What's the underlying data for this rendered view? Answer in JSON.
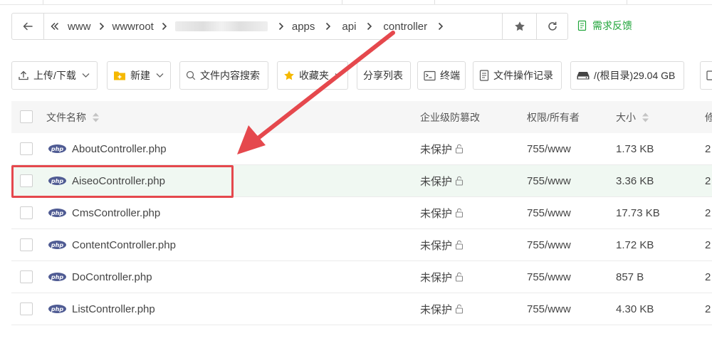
{
  "address_bar": {
    "crumbs": [
      "www",
      "wwwroot",
      "",
      "apps",
      "api",
      "controller"
    ]
  },
  "feedback": {
    "label": "需求反馈"
  },
  "toolbar": {
    "upload": "上传/下载",
    "new": "新建",
    "search_content": "文件内容搜索",
    "favorites": "收藏夹",
    "share_list": "分享列表",
    "terminal": "终端",
    "file_log": "文件操作记录",
    "disk": "/(根目录)29.04 GB"
  },
  "table": {
    "headers": {
      "name": "文件名称",
      "protect": "企业级防篡改",
      "perm": "权限/所有者",
      "size": "大小",
      "modified": "修"
    },
    "rows": [
      {
        "name": "AboutController.php",
        "protect": "未保护",
        "perm": "755/www",
        "size": "1.73 KB",
        "mod": "2"
      },
      {
        "name": "AiseoController.php",
        "protect": "未保护",
        "perm": "755/www",
        "size": "3.36 KB",
        "mod": "2"
      },
      {
        "name": "CmsController.php",
        "protect": "未保护",
        "perm": "755/www",
        "size": "17.73 KB",
        "mod": "2"
      },
      {
        "name": "ContentController.php",
        "protect": "未保护",
        "perm": "755/www",
        "size": "1.72 KB",
        "mod": "2"
      },
      {
        "name": "DoController.php",
        "protect": "未保护",
        "perm": "755/www",
        "size": "857 B",
        "mod": "2"
      },
      {
        "name": "ListController.php",
        "protect": "未保护",
        "perm": "755/www",
        "size": "4.30 KB",
        "mod": "2"
      }
    ]
  },
  "file_icon": {
    "text": "php",
    "color": "#4f5b93"
  },
  "accent": {
    "green": "#20a53a",
    "annotation_red": "#e5484d",
    "highlight_row": "#f0f8f2"
  }
}
